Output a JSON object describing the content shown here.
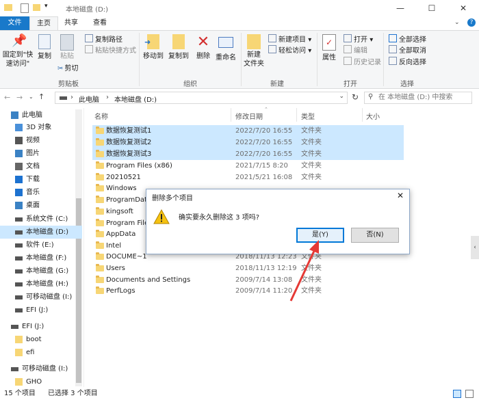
{
  "window": {
    "title": "本地磁盘 (D:)",
    "minimize": "—",
    "maximize": "☐",
    "close": "✕",
    "help": "?"
  },
  "tabs": [
    {
      "label": "文件"
    },
    {
      "label": "主页"
    },
    {
      "label": "共享"
    },
    {
      "label": "查看"
    }
  ],
  "ribbon": {
    "clipboard": {
      "group": "剪贴板",
      "pin": "固定到\"快\n速访问\"",
      "copy": "复制",
      "paste": "粘贴",
      "cut": "剪切",
      "copy_path": "复制路径",
      "paste_shortcut": "粘贴快捷方式"
    },
    "organize": {
      "group": "组织",
      "move_to": "移动到",
      "copy_to": "复制到",
      "delete": "删除",
      "rename": "重命名"
    },
    "new": {
      "group": "新建",
      "new_folder": "新建\n文件夹",
      "new_item": "新建项目",
      "easy_access": "轻松访问"
    },
    "open": {
      "group": "打开",
      "properties": "属性",
      "open": "打开",
      "edit": "编辑",
      "history": "历史记录"
    },
    "select": {
      "group": "选择",
      "select_all": "全部选择",
      "select_none": "全部取消",
      "invert": "反向选择"
    }
  },
  "address": {
    "path1": "此电脑",
    "path2": "本地磁盘 (D:)",
    "search_placeholder": "在 本地磁盘 (D:) 中搜索"
  },
  "nav": [
    {
      "label": "此电脑"
    },
    {
      "label": "3D 对象"
    },
    {
      "label": "视频"
    },
    {
      "label": "图片"
    },
    {
      "label": "文档"
    },
    {
      "label": "下载"
    },
    {
      "label": "音乐"
    },
    {
      "label": "桌面"
    },
    {
      "label": "系统文件 (C:)"
    },
    {
      "label": "本地磁盘 (D:)"
    },
    {
      "label": "软件 (E:)"
    },
    {
      "label": "本地磁盘 (F:)"
    },
    {
      "label": "本地磁盘 (G:)"
    },
    {
      "label": "本地磁盘 (H:)"
    },
    {
      "label": "可移动磁盘 (I:)"
    },
    {
      "label": "EFI (J:)"
    },
    {
      "label": "EFI (J:)"
    },
    {
      "label": "boot"
    },
    {
      "label": "efi"
    },
    {
      "label": "可移动磁盘 (I:)"
    },
    {
      "label": "GHO"
    }
  ],
  "columns": {
    "name": "名称",
    "date": "修改日期",
    "type": "类型",
    "size": "大小"
  },
  "files": [
    {
      "name": "数据恢复测试1",
      "date": "2022/7/20 16:55",
      "type": "文件夹"
    },
    {
      "name": "数据恢复测试2",
      "date": "2022/7/20 16:55",
      "type": "文件夹"
    },
    {
      "name": "数据恢复测试3",
      "date": "2022/7/20 16:55",
      "type": "文件夹"
    },
    {
      "name": "Program Files (x86)",
      "date": "2021/7/15 8:20",
      "type": "文件夹"
    },
    {
      "name": "20210521",
      "date": "2021/5/21 16:08",
      "type": "文件夹"
    },
    {
      "name": "Windows",
      "date": "",
      "type": ""
    },
    {
      "name": "ProgramData",
      "date": "",
      "type": ""
    },
    {
      "name": "kingsoft",
      "date": "",
      "type": ""
    },
    {
      "name": "Program Files",
      "date": "",
      "type": ""
    },
    {
      "name": "AppData",
      "date": "",
      "type": ""
    },
    {
      "name": "Intel",
      "date": "",
      "type": ""
    },
    {
      "name": "DOCUME~1",
      "date": "2018/11/13 12:23",
      "type": "文件夹"
    },
    {
      "name": "Users",
      "date": "2018/11/13 12:19",
      "type": "文件夹"
    },
    {
      "name": "Documents and Settings",
      "date": "2009/7/14 13:08",
      "type": "文件夹"
    },
    {
      "name": "PerfLogs",
      "date": "2009/7/14 11:20",
      "type": "文件夹"
    }
  ],
  "status": {
    "count": "15 个项目",
    "selected": "已选择 3 个项目"
  },
  "dialog": {
    "title": "删除多个项目",
    "message": "确实要永久删除这 3 项吗?",
    "yes": "是(Y)",
    "no": "否(N)",
    "close": "✕"
  },
  "colors": {
    "accent": "#1979ca",
    "selection": "#cce8ff",
    "folder": "#f7d675",
    "arrow": "#e53935"
  }
}
